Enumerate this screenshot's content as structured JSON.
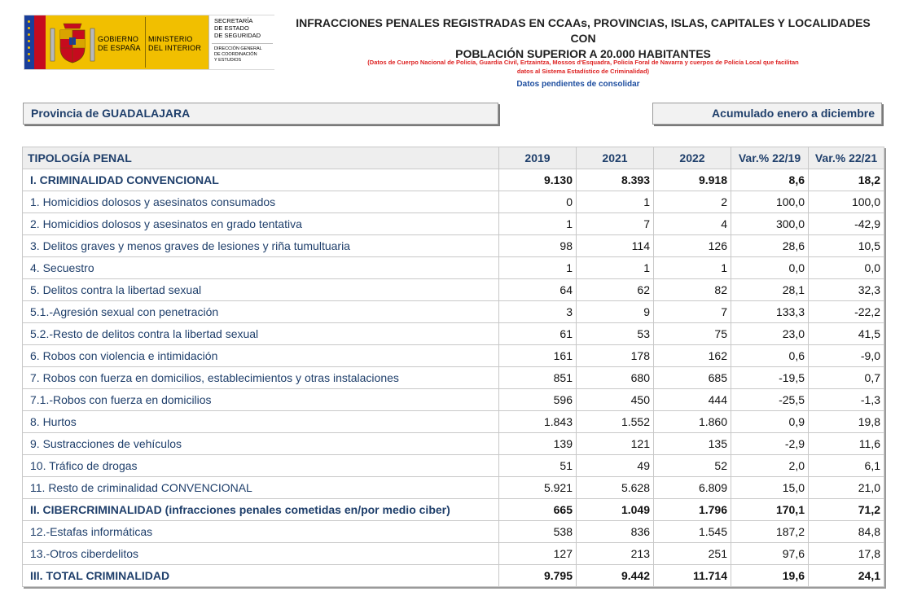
{
  "logo": {
    "gobierno": [
      "GOBIERNO",
      "DE ESPAÑA"
    ],
    "ministerio": [
      "MINISTERIO",
      "DEL INTERIOR"
    ],
    "secretaria": [
      "SECRETARÍA",
      "DE ESTADO",
      "DE SEGURIDAD"
    ],
    "direccion": [
      "DIRECCIÓN GENERAL",
      "DE COORDINACIÓN",
      "Y ESTUDIOS"
    ]
  },
  "header": {
    "title_line1": "INFRACCIONES PENALES REGISTRADAS EN CCAAs, PROVINCIAS, ISLAS, CAPITALES Y LOCALIDADES CON",
    "title_line2": "POBLACIÓN SUPERIOR A 20.000 HABITANTES",
    "note_line1": "(Datos de Cuerpo Nacional de Policía, Guardia Civil, Ertzaintza, Mossos d'Esquadra, Policía Foral de Navarra y cuerpos de Policía Local que facilitan",
    "note_line2": "datos al Sistema Estadístico de Criminalidad)",
    "pending": "Datos pendientes de consolidar"
  },
  "province_label": "Provincia de GUADALAJARA",
  "period_label": "Acumulado enero a diciembre",
  "table": {
    "headers": [
      "TIPOLOGÍA PENAL",
      "2019",
      "2021",
      "2022",
      "Var.% 22/19",
      "Var.% 22/21"
    ],
    "rows": [
      {
        "label": "I. CRIMINALIDAD CONVENCIONAL",
        "bold": true,
        "v": [
          "9.130",
          "8.393",
          "9.918",
          "8,6",
          "18,2"
        ]
      },
      {
        "label": "1. Homicidios dolosos y asesinatos consumados",
        "bold": false,
        "v": [
          "0",
          "1",
          "2",
          "100,0",
          "100,0"
        ]
      },
      {
        "label": "2. Homicidios dolosos y asesinatos en grado tentativa",
        "bold": false,
        "v": [
          "1",
          "7",
          "4",
          "300,0",
          "-42,9"
        ]
      },
      {
        "label": "3. Delitos graves y menos graves de lesiones y riña tumultuaria",
        "bold": false,
        "v": [
          "98",
          "114",
          "126",
          "28,6",
          "10,5"
        ]
      },
      {
        "label": "4. Secuestro",
        "bold": false,
        "v": [
          "1",
          "1",
          "1",
          "0,0",
          "0,0"
        ]
      },
      {
        "label": "5. Delitos contra la libertad sexual",
        "bold": false,
        "v": [
          "64",
          "62",
          "82",
          "28,1",
          "32,3"
        ]
      },
      {
        "label": "5.1.-Agresión sexual con penetración",
        "bold": false,
        "v": [
          "3",
          "9",
          "7",
          "133,3",
          "-22,2"
        ]
      },
      {
        "label": "5.2.-Resto de delitos contra la libertad sexual",
        "bold": false,
        "v": [
          "61",
          "53",
          "75",
          "23,0",
          "41,5"
        ]
      },
      {
        "label": "6. Robos con violencia e intimidación",
        "bold": false,
        "v": [
          "161",
          "178",
          "162",
          "0,6",
          "-9,0"
        ]
      },
      {
        "label": "7. Robos con fuerza en domicilios, establecimientos y otras instalaciones",
        "bold": false,
        "v": [
          "851",
          "680",
          "685",
          "-19,5",
          "0,7"
        ]
      },
      {
        "label": "7.1.-Robos con fuerza en domicilios",
        "bold": false,
        "v": [
          "596",
          "450",
          "444",
          "-25,5",
          "-1,3"
        ]
      },
      {
        "label": "8. Hurtos",
        "bold": false,
        "v": [
          "1.843",
          "1.552",
          "1.860",
          "0,9",
          "19,8"
        ]
      },
      {
        "label": "9. Sustracciones de vehículos",
        "bold": false,
        "v": [
          "139",
          "121",
          "135",
          "-2,9",
          "11,6"
        ]
      },
      {
        "label": "10. Tráfico de drogas",
        "bold": false,
        "v": [
          "51",
          "49",
          "52",
          "2,0",
          "6,1"
        ]
      },
      {
        "label": "11. Resto de criminalidad CONVENCIONAL",
        "bold": false,
        "v": [
          "5.921",
          "5.628",
          "6.809",
          "15,0",
          "21,0"
        ]
      },
      {
        "label": "II. CIBERCRIMINALIDAD (infracciones penales cometidas en/por medio ciber)",
        "bold": true,
        "v": [
          "665",
          "1.049",
          "1.796",
          "170,1",
          "71,2"
        ]
      },
      {
        "label": "12.-Estafas informáticas",
        "bold": false,
        "v": [
          "538",
          "836",
          "1.545",
          "187,2",
          "84,8"
        ]
      },
      {
        "label": "13.-Otros ciberdelitos",
        "bold": false,
        "v": [
          "127",
          "213",
          "251",
          "97,6",
          "17,8"
        ]
      },
      {
        "label": "III. TOTAL CRIMINALIDAD",
        "bold": true,
        "v": [
          "9.795",
          "9.442",
          "11.714",
          "19,6",
          "24,1"
        ]
      }
    ]
  }
}
